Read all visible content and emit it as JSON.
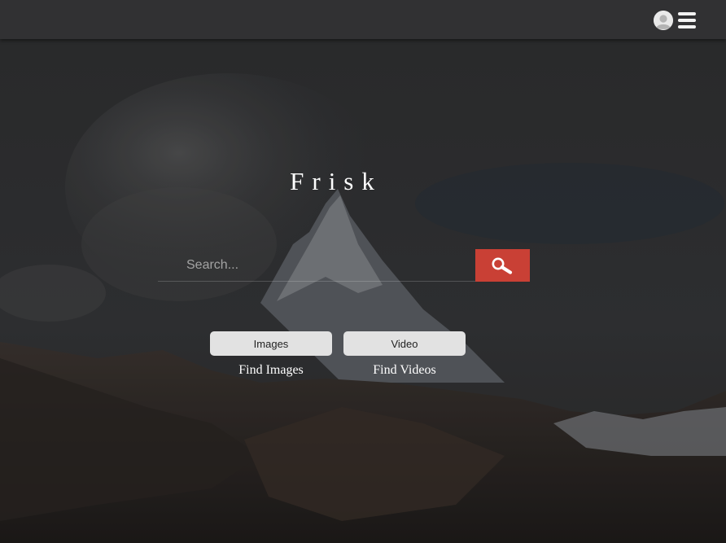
{
  "app": {
    "title": "Frisk"
  },
  "header": {
    "icons": [
      "user-avatar-icon",
      "hamburger-menu-icon"
    ]
  },
  "search": {
    "placeholder": "Search...",
    "value": "",
    "button_icon": "magnifier-icon",
    "button_color": "#c94035"
  },
  "actions": [
    {
      "label": "Images",
      "caption": "Find Images"
    },
    {
      "label": "Video",
      "caption": "Find Videos"
    }
  ],
  "colors": {
    "topbar": "#323234",
    "accent": "#c94035",
    "pill": "#e2e2e2",
    "text": "#ffffff"
  }
}
